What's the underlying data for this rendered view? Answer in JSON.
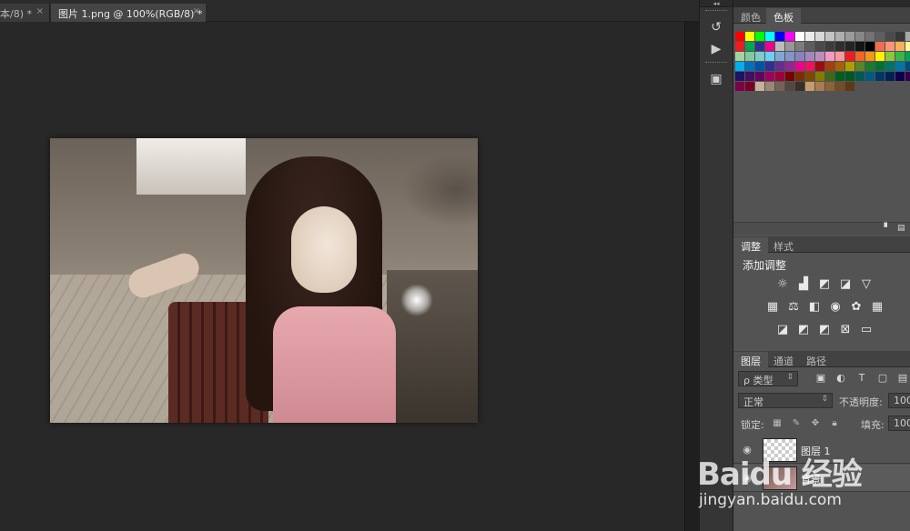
{
  "tabs": [
    {
      "label": "本/8) *",
      "close": "×"
    },
    {
      "label": "图片 1.png @ 100%(RGB/8) *",
      "close": "×"
    }
  ],
  "dock": {
    "collapse_arrows": "◂◂",
    "buttons": [
      "history-icon",
      "play-icon",
      "properties-icon"
    ]
  },
  "panels": {
    "expand_arrows": "▸▸",
    "swatches_tabs": [
      {
        "label": "颜色",
        "active": false
      },
      {
        "label": "色板",
        "active": true
      }
    ],
    "swatches": [
      "#ff0000",
      "#ffff00",
      "#00ff00",
      "#00ffff",
      "#0000ff",
      "#ff00ff",
      "#ffffff",
      "#ebebeb",
      "#d7d7d7",
      "#c3c3c3",
      "#afafaf",
      "#9b9b9b",
      "#878787",
      "#737373",
      "#5f5f5f",
      "#4b4b4b",
      "#373737",
      "#a8a8a8",
      "#ff0000",
      "#ed1c24",
      "#00a651",
      "#2e3192",
      "#ec008c",
      "#bcbcbc",
      "#989898",
      "#7c7c7c",
      "#5e5e5e",
      "#4a4a4a",
      "#3c3c3c",
      "#2e2e2e",
      "#242424",
      "#141414",
      "#000000",
      "#f26c4f",
      "#f7977a",
      "#fbaf5d",
      "#fff79a",
      "#c4df9b",
      "#a3d39c",
      "#82ca9d",
      "#7bcdc8",
      "#6ecff6",
      "#7ea7d8",
      "#8493ca",
      "#8882be",
      "#a187be",
      "#bc8dbf",
      "#f49ac2",
      "#f6989d",
      "#ed1c24",
      "#f26522",
      "#f7941d",
      "#fff200",
      "#8dc63f",
      "#39b54a",
      "#00a651",
      "#00a99d",
      "#00aeef",
      "#0072bc",
      "#0054a6",
      "#2e3192",
      "#662d91",
      "#92278f",
      "#ec008c",
      "#ed145b",
      "#9e0b0f",
      "#a0410d",
      "#a36209",
      "#aba000",
      "#598527",
      "#197b30",
      "#007236",
      "#00746b",
      "#0076a3",
      "#004b80",
      "#003471",
      "#1b1464",
      "#440e62",
      "#630460",
      "#9e005d",
      "#9e0039",
      "#790000",
      "#7b2e00",
      "#7d4900",
      "#827b00",
      "#406618",
      "#005e20",
      "#005826",
      "#005952",
      "#005b7f",
      "#003663",
      "#002157",
      "#0d004c",
      "#32004b",
      "#4b0049",
      "#7b0046",
      "#7a0026",
      "#c7b299",
      "#998675",
      "#736357",
      "#534741",
      "#37302a",
      "#c69c6d",
      "#a67c52",
      "#8c6239",
      "#754c24",
      "#603913"
    ],
    "adjustments_tabs": [
      {
        "label": "调整",
        "active": true
      },
      {
        "label": "样式",
        "active": false
      }
    ],
    "adjustments_title": "添加调整",
    "adjustment_icons": [
      [
        "brightness-icon",
        "levels-icon",
        "curves-icon",
        "exposure-icon",
        "vibrance-icon"
      ],
      [
        "hue-saturation-icon",
        "color-balance-icon",
        "black-white-icon",
        "photo-filter-icon",
        "channel-mixer-icon",
        "color-lookup-icon"
      ],
      [
        "invert-icon",
        "posterize-icon",
        "threshold-icon",
        "selective-color-icon",
        "gradient-map-icon"
      ]
    ],
    "layers_tabs": [
      {
        "label": "图层",
        "active": true
      },
      {
        "label": "通道",
        "active": false
      },
      {
        "label": "路径",
        "active": false
      }
    ],
    "filter_kind": "ρ 类型",
    "blend_mode": "正常",
    "opacity_label": "不透明度:",
    "opacity_value": "100",
    "lock_label": "锁定:",
    "fill_label": "填充:",
    "fill_value": "100",
    "layers": [
      {
        "name": "图层 1",
        "selected": false
      },
      {
        "name": "背景",
        "selected": true
      }
    ]
  },
  "watermark": {
    "logo": "Baidu 经验",
    "url": "jingyan.baidu.com"
  }
}
